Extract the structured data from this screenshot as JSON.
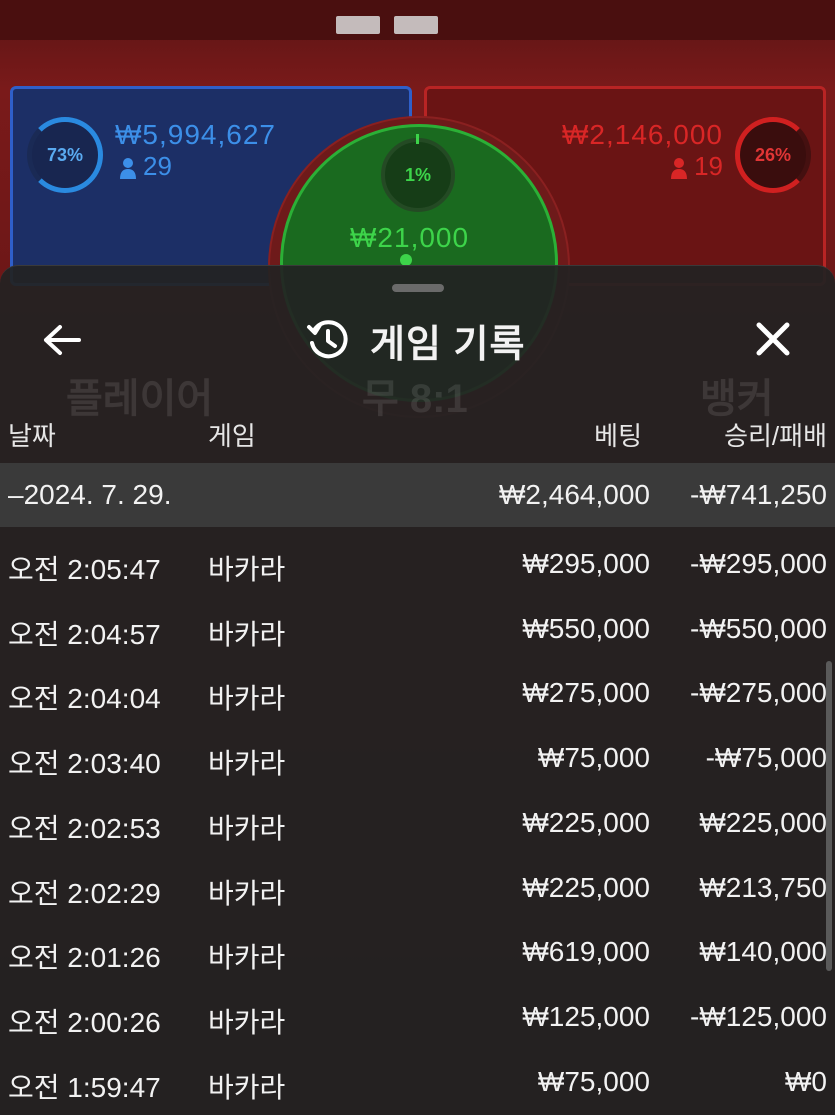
{
  "table": {
    "player": {
      "percent": "73%",
      "amount": "₩5,994,627",
      "count": "29"
    },
    "banker": {
      "percent": "26%",
      "amount": "₩2,146,000",
      "count": "19"
    },
    "tie": {
      "percent": "1%",
      "amount": "₩21,000"
    }
  },
  "ghost_labels": {
    "player": "플레이어",
    "tie": "무 8:1",
    "banker": "뱅커"
  },
  "history": {
    "title": "게임 기록",
    "columns": {
      "date": "날짜",
      "game": "게임",
      "bet": "베팅",
      "result": "승리/패배"
    },
    "date_group": {
      "date": "–2024. 7. 29.",
      "bet": "₩2,464,000",
      "result": "-₩741,250"
    },
    "rows": [
      {
        "time": "오전 2:05:47",
        "game": "바카라",
        "bet": "₩295,000",
        "result": "-₩295,000"
      },
      {
        "time": "오전 2:04:57",
        "game": "바카라",
        "bet": "₩550,000",
        "result": "-₩550,000"
      },
      {
        "time": "오전 2:04:04",
        "game": "바카라",
        "bet": "₩275,000",
        "result": "-₩275,000"
      },
      {
        "time": "오전 2:03:40",
        "game": "바카라",
        "bet": "₩75,000",
        "result": "-₩75,000"
      },
      {
        "time": "오전 2:02:53",
        "game": "바카라",
        "bet": "₩225,000",
        "result": "₩225,000"
      },
      {
        "time": "오전 2:02:29",
        "game": "바카라",
        "bet": "₩225,000",
        "result": "₩213,750"
      },
      {
        "time": "오전 2:01:26",
        "game": "바카라",
        "bet": "₩619,000",
        "result": "₩140,000"
      },
      {
        "time": "오전 2:00:26",
        "game": "바카라",
        "bet": "₩125,000",
        "result": "-₩125,000"
      },
      {
        "time": "오전 1:59:47",
        "game": "바카라",
        "bet": "₩75,000",
        "result": "₩0"
      }
    ]
  },
  "icons": {
    "back": "arrow-left-icon",
    "history": "history-icon",
    "close": "close-icon",
    "person": "person-icon"
  },
  "colors": {
    "player": "#3c8fe8",
    "banker": "#d92626",
    "tie": "#3dd44a",
    "sheet": "#222222"
  }
}
